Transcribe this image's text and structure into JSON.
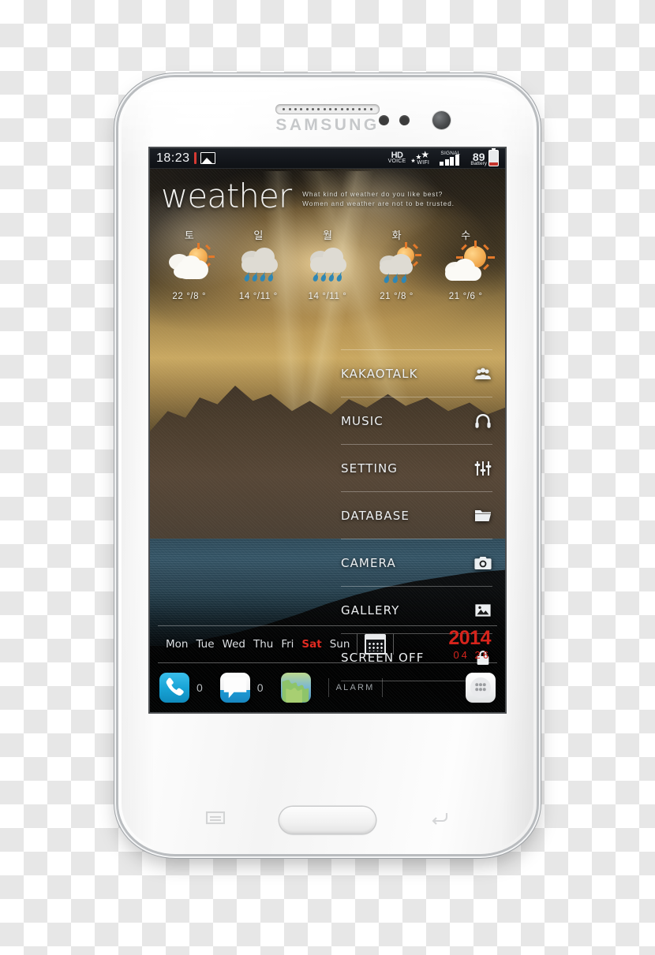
{
  "device": {
    "brand": "SAMSUNG"
  },
  "statusbar": {
    "time": "18:23",
    "screenshot_icon": "image-icon",
    "hd_top": "HD",
    "hd_bottom": "VOICE",
    "wifi_label": "WIFI",
    "signal_label": "SIGNAL",
    "battery_percent": "89",
    "battery_label": "Battery"
  },
  "header": {
    "title": "weather",
    "quote_line1": "What kind of weather do you like best?",
    "quote_line2": "Women and weather are not to be trusted."
  },
  "forecast": [
    {
      "day": "토",
      "condition": "partly-cloudy",
      "temp": "22 °/8 °",
      "high": 22,
      "low": 8
    },
    {
      "day": "일",
      "condition": "rain",
      "temp": "14 °/11 °",
      "high": 14,
      "low": 11
    },
    {
      "day": "월",
      "condition": "rain",
      "temp": "14 °/11 °",
      "high": 14,
      "low": 11
    },
    {
      "day": "화",
      "condition": "sun-rain",
      "temp": "21 °/8 °",
      "high": 21,
      "low": 8
    },
    {
      "day": "수",
      "condition": "mostly-sunny",
      "temp": "21 °/6 °",
      "high": 21,
      "low": 6
    }
  ],
  "menu": [
    {
      "label": "KAKAOTALK",
      "icon": "people-icon"
    },
    {
      "label": "MUSIC",
      "icon": "headphones-icon"
    },
    {
      "label": "SETTING",
      "icon": "sliders-icon"
    },
    {
      "label": "DATABASE",
      "icon": "folder-icon"
    },
    {
      "label": "CAMERA",
      "icon": "camera-icon"
    },
    {
      "label": "GALLERY",
      "icon": "image-icon"
    },
    {
      "label": "SCREEN OFF",
      "icon": "lock-icon"
    }
  ],
  "datebar": {
    "days": [
      {
        "label": "Mon",
        "active": false
      },
      {
        "label": "Tue",
        "active": false
      },
      {
        "label": "Wed",
        "active": false
      },
      {
        "label": "Thu",
        "active": false
      },
      {
        "label": "Fri",
        "active": false
      },
      {
        "label": "Sat",
        "active": true
      },
      {
        "label": "Sun",
        "active": false
      }
    ],
    "calendar_icon": "calendar-icon",
    "year": "2014",
    "month_day": "04  26",
    "accent_color": "#d6241c"
  },
  "dock": {
    "phone_badge": "0",
    "messages_badge": "0",
    "alarm_label": "ALARM",
    "browser_icon": "globe-icon",
    "drawer_icon": "app-drawer-icon"
  },
  "softkeys": {
    "menu": "menu-key",
    "home": "home-button",
    "back": "back-key"
  }
}
